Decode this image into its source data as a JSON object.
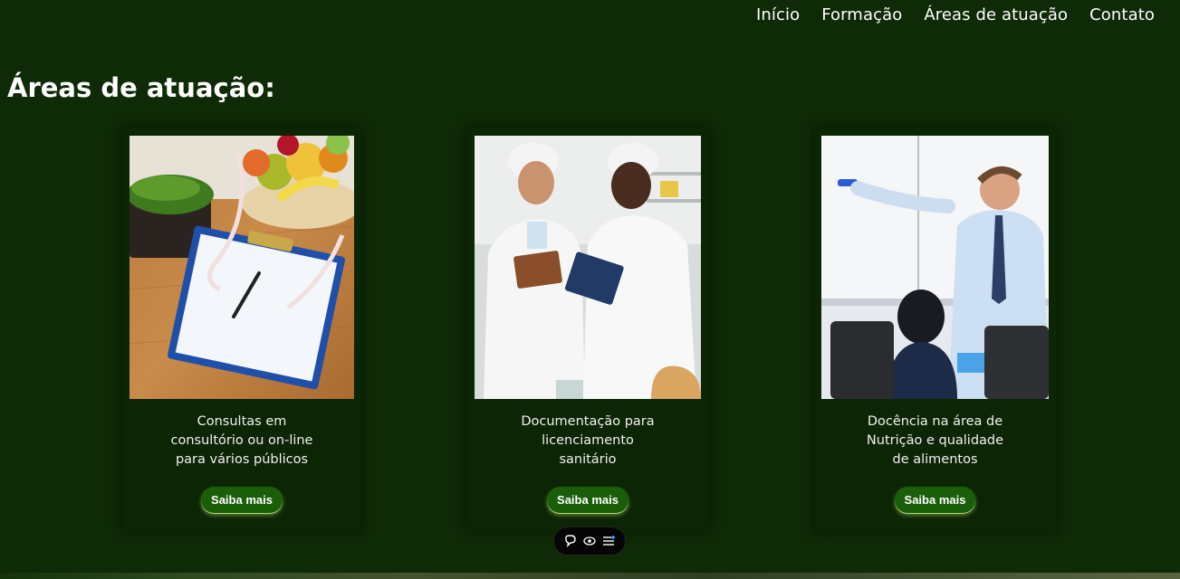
{
  "nav": {
    "items": [
      {
        "label": "Início"
      },
      {
        "label": "Formação"
      },
      {
        "label": "Áreas de atuação"
      },
      {
        "label": "Contato"
      }
    ]
  },
  "section": {
    "title": "Áreas de atuação:"
  },
  "cards": [
    {
      "description": "Consultas em\nconsultório ou on-line\npara vários públicos",
      "button": "Saiba mais",
      "image": "fruit-bowl-clipboard-photo"
    },
    {
      "description": "Documentação para\nlicenciamento\nsanitário",
      "button": "Saiba mais",
      "image": "lab-professionals-photo"
    },
    {
      "description": "Docência na área de\nNutrição e qualidade\nde alimentos",
      "button": "Saiba mais",
      "image": "teacher-whiteboard-photo"
    }
  ],
  "toolbar": {
    "icons": [
      "chat-icon",
      "eye-icon",
      "list-icon"
    ]
  },
  "colors": {
    "background": "#0f2a06",
    "card": "#0c2504",
    "button": "#1b5e0a"
  }
}
